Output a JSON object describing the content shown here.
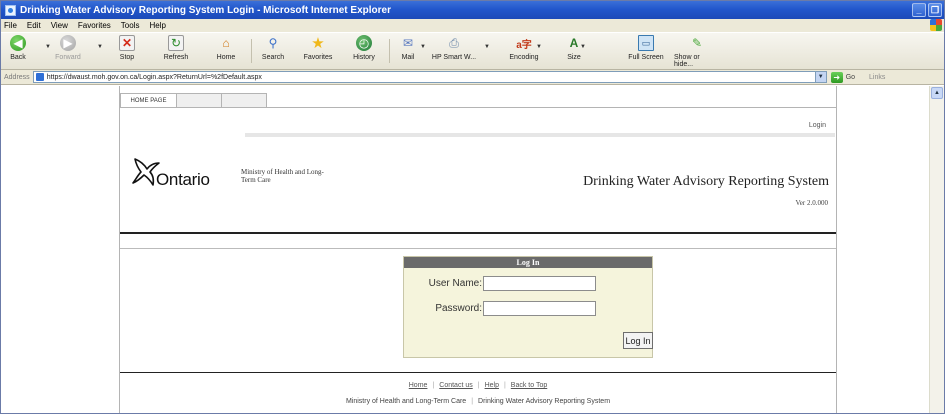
{
  "window": {
    "title": "Drinking Water Advisory Reporting System Login - Microsoft Internet Explorer",
    "buttons": {
      "minimize": "_",
      "maximize": "❐"
    }
  },
  "menu": [
    "File",
    "Edit",
    "View",
    "Favorites",
    "Tools",
    "Help"
  ],
  "toolbar": {
    "back": "Back",
    "forward": "Forward",
    "stop": "Stop",
    "refresh": "Refresh",
    "home": "Home",
    "search": "Search",
    "favorites": "Favorites",
    "history": "History",
    "mail": "Mail",
    "hp_smart": "HP Smart W...",
    "encoding": "Encoding",
    "size": "Size",
    "full_screen": "Full Screen",
    "show_or_hide": "Show or hide..."
  },
  "address_bar": {
    "label": "Address",
    "url": "https://dwaust.moh.gov.on.ca/Login.aspx?ReturnUrl=%2fDefault.aspx",
    "go": "Go",
    "links": "Links"
  },
  "site": {
    "tabs": [
      "HOME PAGE",
      "",
      ""
    ],
    "login_link": "Login",
    "logo_text": "Ontario",
    "ministry": "Ministry of Health and Long-Term Care",
    "system_title": "Drinking Water Advisory Reporting System",
    "version": "Ver 2.0.000"
  },
  "login": {
    "title": "Log In",
    "username_label": "User Name:",
    "username_value": "",
    "password_label": "Password:",
    "password_value": "",
    "button": "Log In"
  },
  "footer": {
    "links": [
      "Home",
      "Contact us",
      "Help",
      "Back to Top"
    ],
    "left_text": "Ministry of Health and Long-Term Care",
    "right_text": "Drinking Water Advisory Reporting System"
  },
  "colors": {
    "titlebar": "#2257cc",
    "login_header": "#6a6a6a",
    "login_panel": "#f5f4dc"
  }
}
